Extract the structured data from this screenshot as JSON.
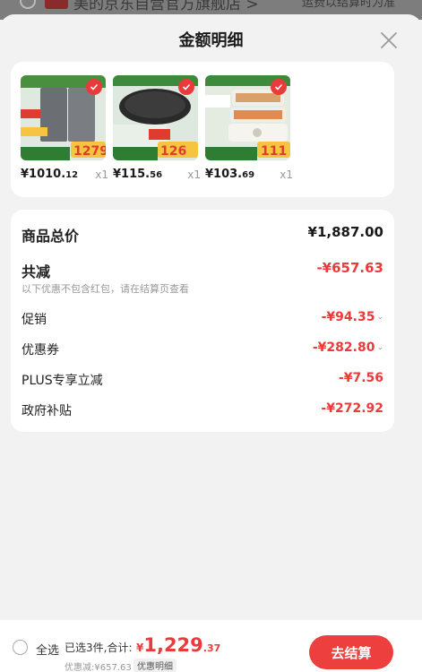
{
  "background": {
    "shop_name": "美的京东自营官方旗舰店 >",
    "right_text": "运费以结算时为准"
  },
  "sheet": {
    "title": "金额明细",
    "close_icon": "close-icon"
  },
  "products": [
    {
      "name": "refrigerator",
      "price_int": "¥1010.",
      "price_dec": "12",
      "qty": "x1",
      "badge_price": "1279"
    },
    {
      "name": "induction-cooker",
      "price_int": "¥115.",
      "price_dec": "56",
      "qty": "x1",
      "badge_price": "126"
    },
    {
      "name": "food-steamer",
      "price_int": "¥103.",
      "price_dec": "69",
      "qty": "x1",
      "badge_price": "111"
    }
  ],
  "detail": {
    "total_label": "商品总价",
    "total_value": "¥1,887.00",
    "reduce_label": "共减",
    "reduce_value": "-¥657.63",
    "note": "以下优惠不包含红包，请在结算页查看",
    "promo_label": "促销",
    "promo_value": "-¥94.35",
    "coupon_label": "优惠券",
    "coupon_value": "-¥282.80",
    "plus_label": "PLUS专享立减",
    "plus_value": "-¥7.56",
    "subsidy_label": "政府补贴",
    "subsidy_value": "-¥272.92"
  },
  "footer": {
    "select_all": "全选",
    "summary": "已选3件,合计:",
    "amount_cur": "¥",
    "amount_int": "1,229",
    "amount_dec": ".37",
    "discount": "优惠减:¥657.63",
    "promo_link": "优惠明细",
    "checkout": "去结算"
  },
  "colors": {
    "accent": "#ee3f3f",
    "price_red": "#e93b3b",
    "background": "#f2f2f2"
  }
}
